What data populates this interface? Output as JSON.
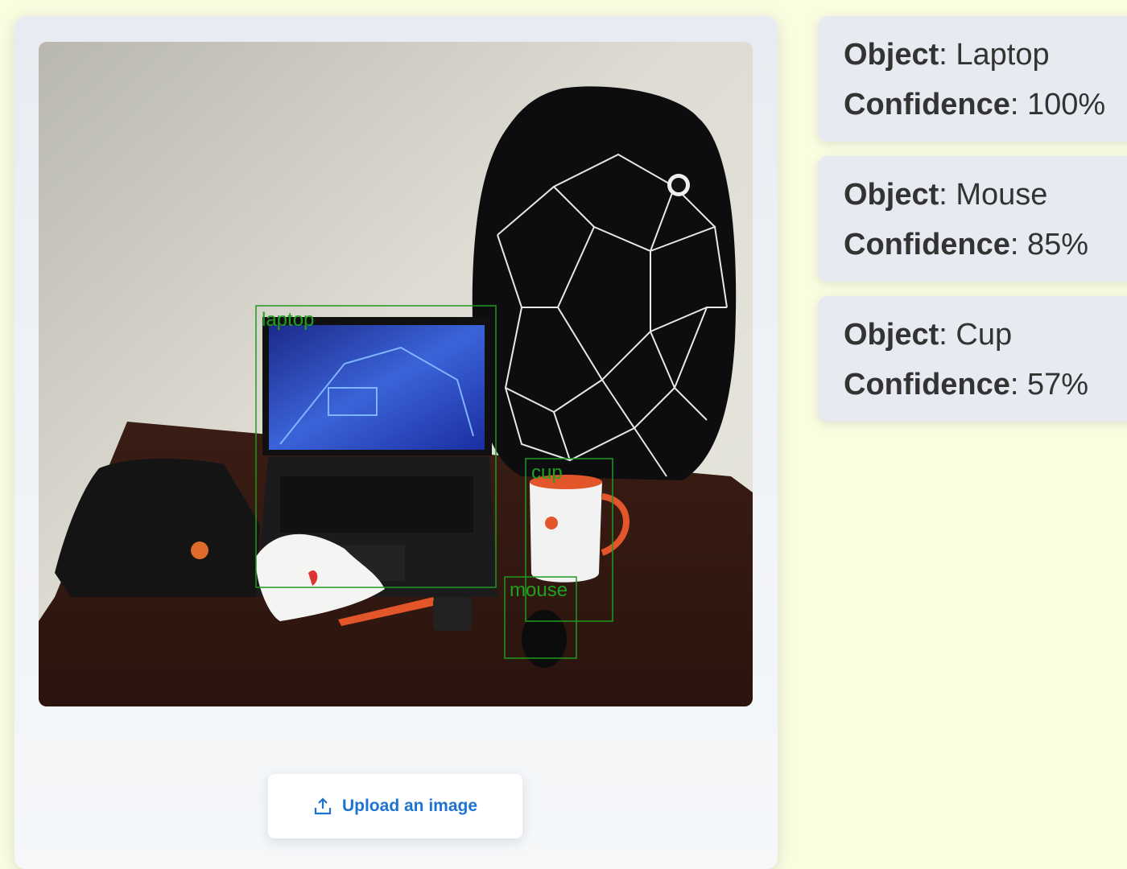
{
  "detections": [
    {
      "label": "laptop",
      "box_color": "#1f9a1f"
    },
    {
      "label": "cup",
      "box_color": "#1f9a1f"
    },
    {
      "label": "mouse",
      "box_color": "#1f9a1f"
    }
  ],
  "upload": {
    "label": "Upload an image",
    "icon": "upload-icon"
  },
  "results": [
    {
      "object_key": "Object",
      "object_value": "Laptop",
      "confidence_key": "Confidence",
      "confidence_value": "100%"
    },
    {
      "object_key": "Object",
      "object_value": "Mouse",
      "confidence_key": "Confidence",
      "confidence_value": "85%"
    },
    {
      "object_key": "Object",
      "object_value": "Cup",
      "confidence_key": "Confidence",
      "confidence_value": "57%"
    }
  ],
  "colors": {
    "page_bg": "#fbfde0",
    "accent": "#1e73d2",
    "detection": "#1f9a1f"
  }
}
